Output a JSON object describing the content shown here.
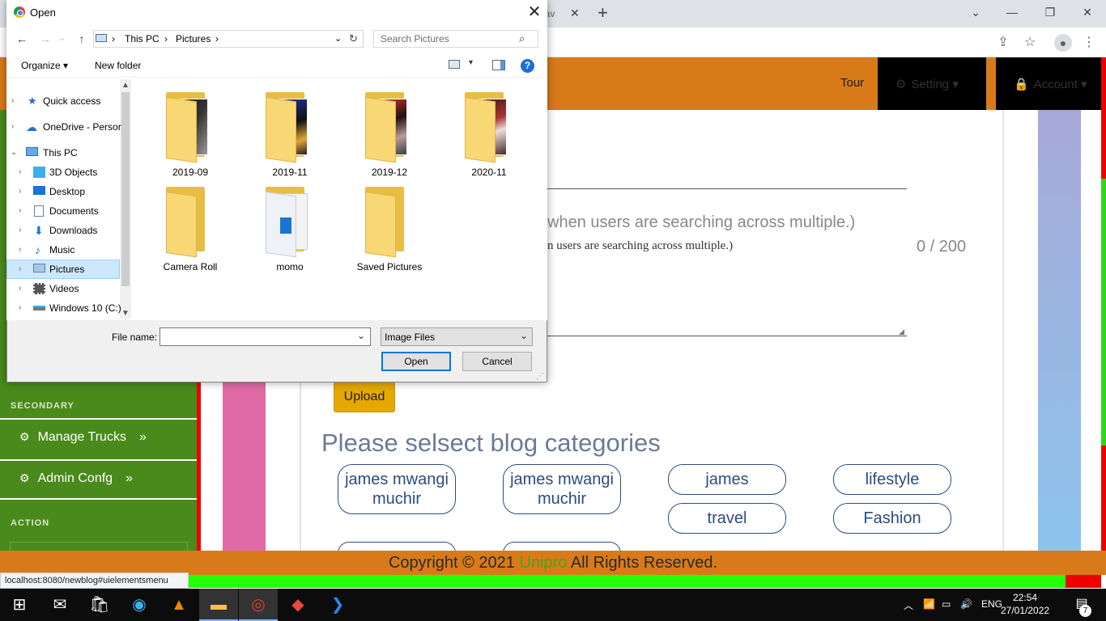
{
  "browser": {
    "tab_fragment": "arav",
    "new_tab": "+",
    "minimize": "—",
    "restore": "❐",
    "close": "✕",
    "dropdown": "⌄"
  },
  "topnav": {
    "tour": "Tour",
    "setting": "Setting",
    "account": "Account"
  },
  "sidebar": {
    "secondary_label": "SECONDARY",
    "items": [
      {
        "label": "Manage Trucks"
      },
      {
        "label": "Admin Confg"
      }
    ],
    "action_label": "ACTION"
  },
  "form": {
    "hint_large": "when users are searching across multiple.)",
    "hint_small": "n users are searching across multiple.)",
    "counter": "0 / 200",
    "upload_label": "Upload"
  },
  "categories": {
    "title": "Please selsect blog categories",
    "items": [
      "james mwangi muchir",
      "james mwangi muchir",
      "james",
      "lifestyle",
      "travel",
      "Fashion"
    ]
  },
  "footer": {
    "prefix": "Copyright © 2021",
    "brand": "Unipro",
    "suffix": "All Rights Reserved."
  },
  "status_url": "localhost:8080/newblog#uielementsmenu",
  "taskbar": {
    "language": "ENG",
    "time": "22:54",
    "date": "27/01/2022",
    "notifications": "7"
  },
  "dialog": {
    "title": "Open",
    "breadcrumb": [
      "This PC",
      "Pictures"
    ],
    "search_placeholder": "Search Pictures",
    "organize": "Organize",
    "new_folder": "New folder",
    "help": "?",
    "nav_tree": [
      {
        "label": "Quick access",
        "icon": "star-icon"
      },
      {
        "label": "OneDrive - Persor",
        "icon": "cloud-icon"
      },
      {
        "label": "This PC",
        "icon": "computer-icon"
      },
      {
        "label": "3D Objects",
        "icon": "cube-icon"
      },
      {
        "label": "Desktop",
        "icon": "desktop-icon"
      },
      {
        "label": "Documents",
        "icon": "document-icon"
      },
      {
        "label": "Downloads",
        "icon": "download-icon"
      },
      {
        "label": "Music",
        "icon": "music-icon"
      },
      {
        "label": "Pictures",
        "icon": "pictures-icon",
        "selected": true
      },
      {
        "label": "Videos",
        "icon": "video-icon"
      },
      {
        "label": "Windows 10 (C:)",
        "icon": "drive-icon"
      }
    ],
    "folders": [
      "2019-09",
      "2019-11",
      "2019-12",
      "2020-11",
      "Camera Roll",
      "momo",
      "Saved Pictures"
    ],
    "file_name_label": "File name:",
    "file_name_value": "",
    "file_type": "Image Files",
    "open_label": "Open",
    "cancel_label": "Cancel"
  },
  "colors": {
    "orange": "#d97a1a",
    "sidebar_green": "#4a8a1c",
    "bright_green": "#26ff0a",
    "red": "#ee0000",
    "pink": "#e06aa5",
    "category_blue": "#2c4b80"
  }
}
